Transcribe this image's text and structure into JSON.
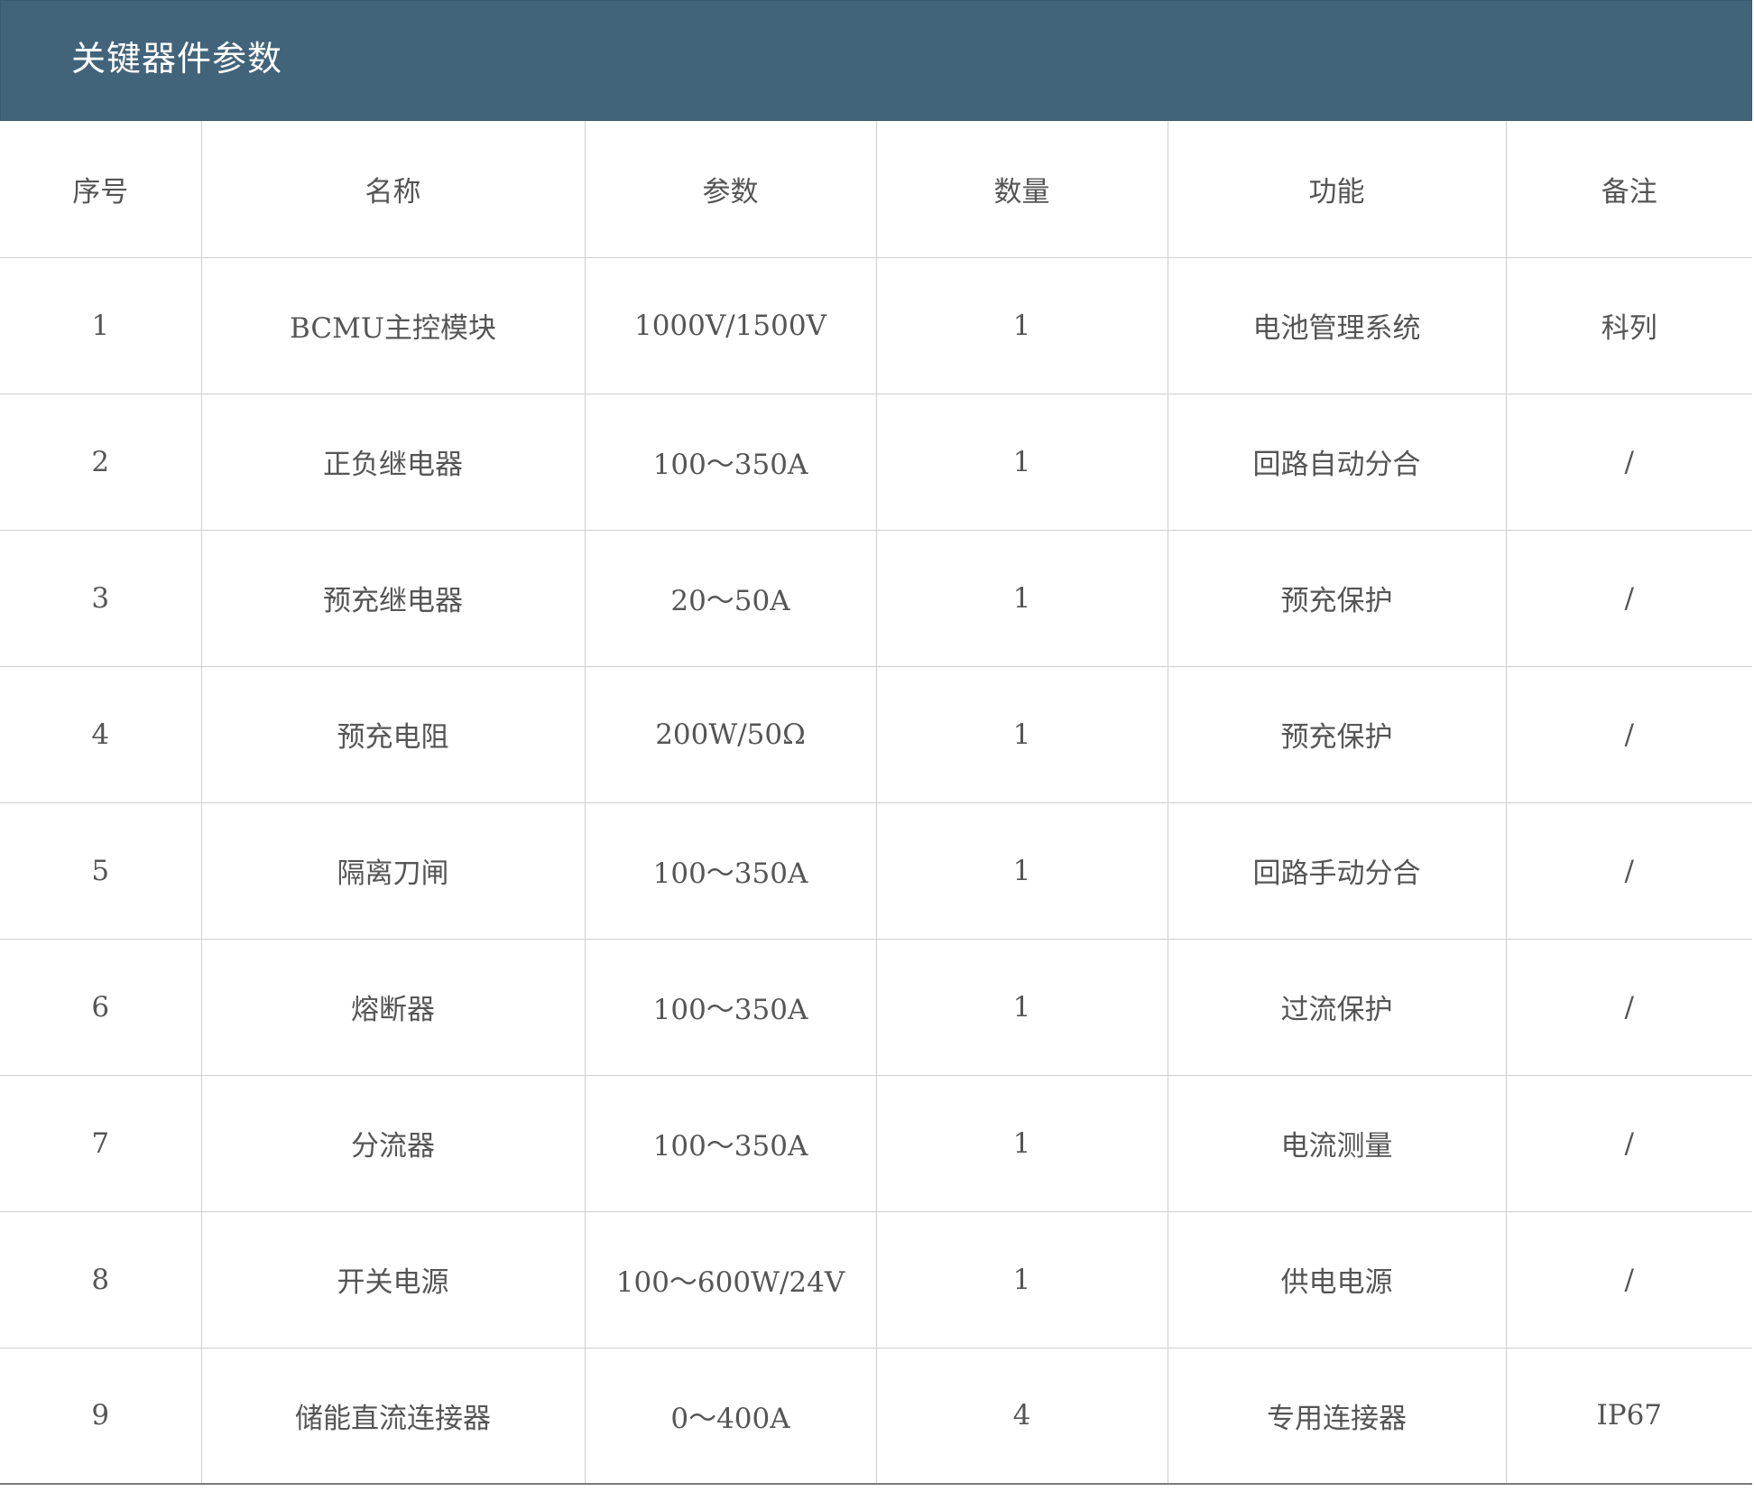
{
  "title": "关键器件参数",
  "table": {
    "headers": [
      "序号",
      "名称",
      "参数",
      "数量",
      "功能",
      "备注"
    ],
    "rows": [
      [
        "1",
        "BCMU主控模块",
        "1000V/1500V",
        "1",
        "电池管理系统",
        "科列"
      ],
      [
        "2",
        "正负继电器",
        "100～350A",
        "1",
        "回路自动分合",
        "/"
      ],
      [
        "3",
        "预充继电器",
        "20～50A",
        "1",
        "预充保护",
        "/"
      ],
      [
        "4",
        "预充电阻",
        "200W/50Ω",
        "1",
        "预充保护",
        "/"
      ],
      [
        "5",
        "隔离刀闸",
        "100～350A",
        "1",
        "回路手动分合",
        "/"
      ],
      [
        "6",
        "熔断器",
        "100～350A",
        "1",
        "过流保护",
        "/"
      ],
      [
        "7",
        "分流器",
        "100～350A",
        "1",
        "电流测量",
        "/"
      ],
      [
        "8",
        "开关电源",
        "100～600W/24V",
        "1",
        "供电电源",
        "/"
      ],
      [
        "9",
        "储能直流连接器",
        "0～400A",
        "4",
        "专用连接器",
        "IP67"
      ]
    ]
  },
  "colors": {
    "header_bar": "#42647b",
    "header_text": "#ffffff",
    "body_text": "#555555",
    "grid_line": "#cfcfcf"
  }
}
